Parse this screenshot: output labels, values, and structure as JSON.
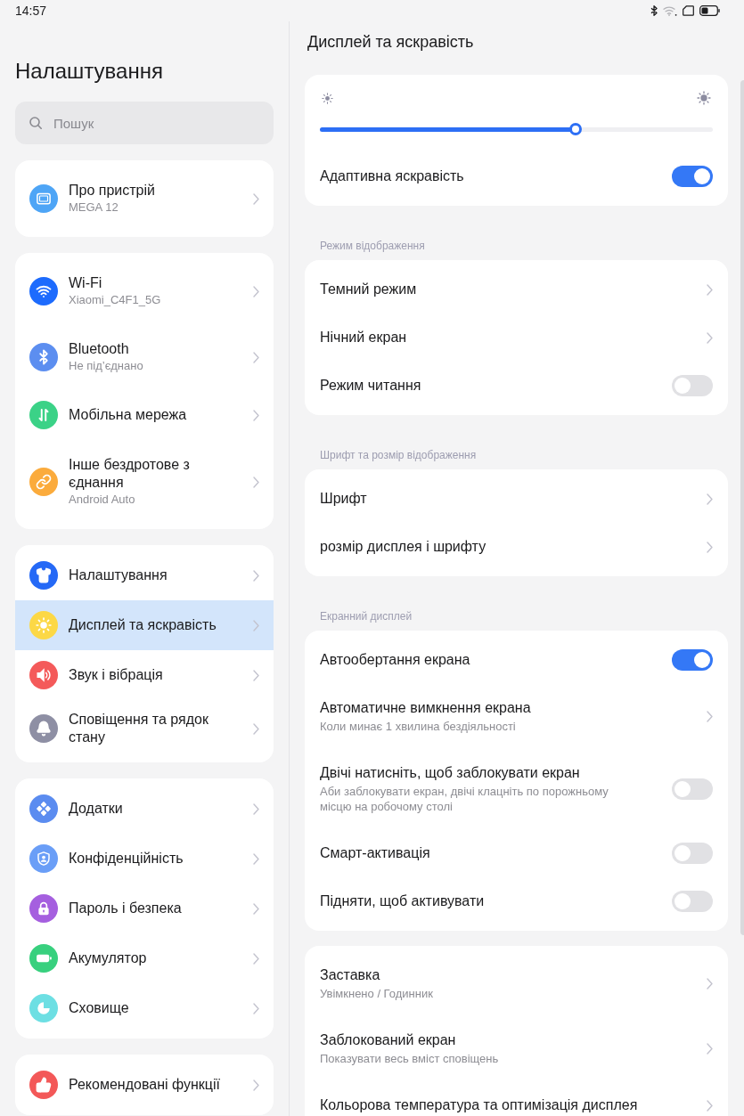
{
  "status_bar": {
    "time": "14:57"
  },
  "sidebar": {
    "title": "Налаштування",
    "search": {
      "placeholder": "Пошук"
    },
    "groups": [
      {
        "items": [
          {
            "label": "Про пристрій",
            "subtitle": "MEGA 12",
            "color": "#4ea5f6",
            "selected": false
          }
        ]
      },
      {
        "items": [
          {
            "label": "Wi-Fi",
            "subtitle": "Xiaomi_C4F1_5G",
            "color": "#1d6bfd",
            "selected": false
          },
          {
            "label": "Bluetooth",
            "subtitle": "Не під’єднано",
            "color": "#5c8ef0",
            "selected": false
          },
          {
            "label": "Мобільна мережа",
            "color": "#3bd287",
            "selected": false
          },
          {
            "label": "Інше бездротове з єднання",
            "subtitle": "Android Auto",
            "color": "#fbab3c",
            "selected": false
          }
        ]
      },
      {
        "items": [
          {
            "label": "Налаштування",
            "color": "#2569f6",
            "selected": false
          },
          {
            "label": "Дисплей та яскравість",
            "color": "#fcd846",
            "selected": true
          },
          {
            "label": "Звук і вібрація",
            "color": "#f45a5a",
            "selected": false
          },
          {
            "label": "Сповіщення та рядок стану",
            "color": "#8e8fa4",
            "selected": false
          }
        ]
      },
      {
        "items": [
          {
            "label": "Додатки",
            "color": "#5b8cf0",
            "selected": false
          },
          {
            "label": "Конфіденційність",
            "color": "#6a9ef7",
            "selected": false
          },
          {
            "label": "Пароль і безпека",
            "color": "#a55fdf",
            "selected": false
          },
          {
            "label": "Акумулятор",
            "color": "#38d07e",
            "selected": false
          },
          {
            "label": "Сховище",
            "color": "#6ddfe3",
            "selected": false
          }
        ]
      },
      {
        "items": [
          {
            "label": "Рекомендовані функції",
            "color": "#f35858",
            "selected": false
          }
        ]
      }
    ]
  },
  "content": {
    "title": "Дисплей та яскравість",
    "cards": [
      {
        "rows": [
          {
            "kind": "slider",
            "level": 0.65
          },
          {
            "kind": "toggle",
            "label": "Адаптивна яскравість",
            "on": true
          }
        ]
      },
      {
        "header": "Режим відображення",
        "rows": [
          {
            "kind": "link",
            "label": "Темний режим"
          },
          {
            "kind": "link",
            "label": "Нічний екран"
          },
          {
            "kind": "toggle",
            "label": "Режим читання",
            "on": false
          }
        ]
      },
      {
        "header": "Шрифт та розмір відображення",
        "rows": [
          {
            "kind": "link",
            "label": "Шрифт"
          },
          {
            "kind": "link",
            "label": "розмір дисплея і шрифту"
          }
        ]
      },
      {
        "header": "Екранний дисплей",
        "rows": [
          {
            "kind": "toggle",
            "label": "Автообертання екрана",
            "on": true
          },
          {
            "kind": "link",
            "label": "Автоматичне вимкнення екрана",
            "subtitle": "Коли минає 1 хвилина бездіяльності"
          },
          {
            "kind": "toggle",
            "label": "Двічі натисніть, щоб заблокувати екран",
            "subtitle": "Аби заблокувати екран, двічі клацніть по порожньому місцю на робочому столі",
            "on": false
          },
          {
            "kind": "toggle",
            "label": "Смарт-активація",
            "on": false
          },
          {
            "kind": "toggle",
            "label": "Підняти, щоб активувати",
            "on": false
          }
        ]
      },
      {
        "rows": [
          {
            "kind": "link",
            "label": "Заставка",
            "subtitle": "Увімкнено / Годинник"
          },
          {
            "kind": "link",
            "label": "Заблокований екран",
            "subtitle": "Показувати весь вміст сповіщень"
          },
          {
            "kind": "link",
            "label": "Кольорова температура та оптимізація дисплея"
          }
        ]
      }
    ]
  }
}
